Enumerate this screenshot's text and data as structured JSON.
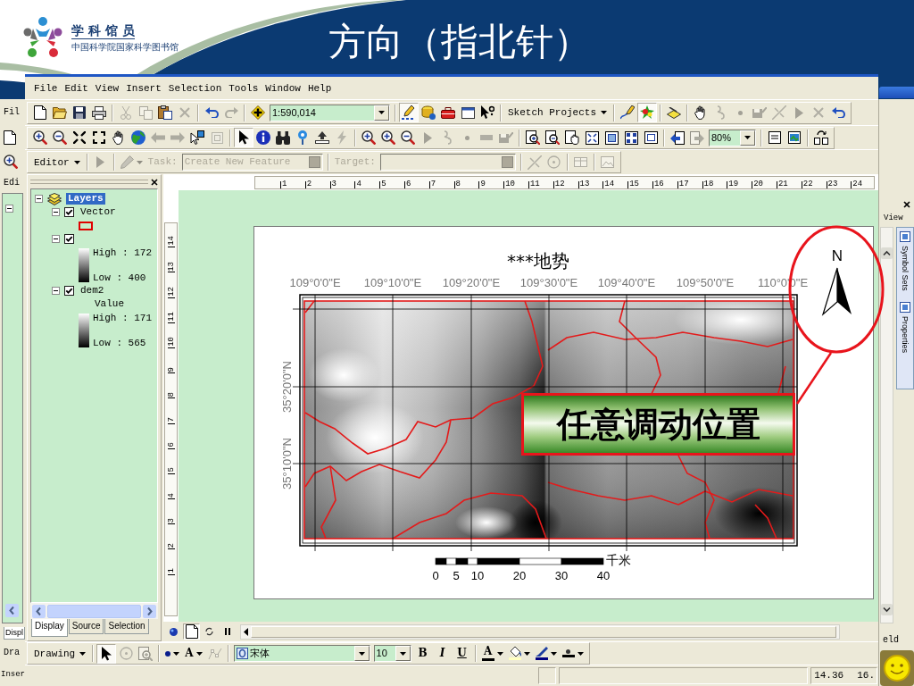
{
  "slide": {
    "logo": {
      "name": "学 科 馆 员",
      "subtitle": "中国科学院国家科学图书馆"
    },
    "title": "方向（指北针）"
  },
  "background_window": {
    "left": {
      "menu": "Fil",
      "panel_tab": "Edi",
      "tab": "Displ",
      "toolbar_menu": "Dra",
      "status": "Inser"
    },
    "right": {
      "tab": "View",
      "vertical_tabs": [
        "Symbol Sets",
        "Properties"
      ],
      "field": "eld"
    }
  },
  "menu_bar": [
    "File",
    "Edit",
    "View",
    "Insert",
    "Selection",
    "Tools",
    "Window",
    "Help"
  ],
  "toolbars": [
    {
      "groups": [
        [
          {
            "kind": "tool",
            "disabled": false,
            "pressed": false
          },
          {
            "kind": "tool",
            "disabled": false,
            "pressed": false
          },
          {
            "kind": "tool",
            "disabled": false,
            "pressed": false
          },
          {
            "kind": "tool",
            "disabled": false,
            "pressed": false
          }
        ],
        [
          {
            "kind": "tool",
            "disabled": true,
            "pressed": false
          },
          {
            "kind": "tool",
            "disabled": true,
            "pressed": false
          },
          {
            "kind": "tool",
            "disabled": false,
            "pressed": false
          },
          {
            "kind": "tool",
            "disabled": true,
            "pressed": false
          }
        ],
        [
          {
            "kind": "tool",
            "disabled": false,
            "pressed": false
          },
          {
            "kind": "tool",
            "disabled": true,
            "pressed": false
          }
        ],
        [
          {
            "kind": "tool",
            "disabled": false,
            "pressed": false
          },
          {
            "kind": "combo",
            "value": "1:590,014"
          }
        ],
        [
          {
            "kind": "tool",
            "disabled": false,
            "pressed": true
          },
          {
            "kind": "tool",
            "disabled": false,
            "pressed": false
          },
          {
            "kind": "tool",
            "disabled": false,
            "pressed": false
          },
          {
            "kind": "tool",
            "disabled": false,
            "pressed": false
          },
          {
            "kind": "tool",
            "disabled": false,
            "pressed": false
          }
        ],
        [
          {
            "kind": "menu",
            "label": "Sketch Projects"
          }
        ],
        [
          {
            "kind": "tool",
            "disabled": false,
            "pressed": false
          },
          {
            "kind": "tool",
            "disabled": false,
            "pressed": true
          }
        ],
        [
          {
            "kind": "tool",
            "disabled": false,
            "pressed": false
          }
        ],
        [
          {
            "kind": "tool",
            "disabled": false,
            "pressed": false
          },
          {
            "kind": "tool",
            "disabled": true,
            "pressed": false
          },
          {
            "kind": "tool",
            "disabled": true,
            "pressed": false
          },
          {
            "kind": "tool",
            "disabled": true,
            "pressed": false
          },
          {
            "kind": "tool",
            "disabled": true,
            "pressed": false
          },
          {
            "kind": "tool",
            "disabled": true,
            "pressed": false
          },
          {
            "kind": "tool",
            "disabled": true,
            "pressed": false
          },
          {
            "kind": "tool",
            "disabled": false,
            "pressed": false
          }
        ]
      ]
    },
    {
      "groups": [
        [
          {
            "kind": "tool",
            "disabled": false,
            "pressed": false
          },
          {
            "kind": "tool",
            "disabled": false,
            "pressed": false
          },
          {
            "kind": "tool",
            "disabled": false,
            "pressed": false
          },
          {
            "kind": "tool",
            "disabled": false,
            "pressed": false
          },
          {
            "kind": "tool",
            "disabled": false,
            "pressed": false
          },
          {
            "kind": "tool",
            "disabled": false,
            "pressed": false
          },
          {
            "kind": "tool",
            "disabled": true,
            "pressed": false
          },
          {
            "kind": "tool",
            "disabled": true,
            "pressed": false
          },
          {
            "kind": "tool",
            "disabled": false,
            "pressed": false
          },
          {
            "kind": "tool",
            "disabled": true,
            "pressed": false
          }
        ],
        [
          {
            "kind": "tool",
            "disabled": false,
            "pressed": true
          },
          {
            "kind": "tool",
            "disabled": false,
            "pressed": false
          },
          {
            "kind": "tool",
            "disabled": false,
            "pressed": false
          },
          {
            "kind": "tool",
            "disabled": false,
            "pressed": false
          },
          {
            "kind": "tool",
            "disabled": false,
            "pressed": false
          },
          {
            "kind": "tool",
            "disabled": true,
            "pressed": false
          }
        ],
        [
          {
            "kind": "tool",
            "disabled": false,
            "pressed": false
          },
          {
            "kind": "tool",
            "disabled": false,
            "pressed": false
          },
          {
            "kind": "tool",
            "disabled": false,
            "pressed": false
          },
          {
            "kind": "tool",
            "disabled": true,
            "pressed": false
          },
          {
            "kind": "tool",
            "disabled": true,
            "pressed": false
          },
          {
            "kind": "tool",
            "disabled": true,
            "pressed": false
          },
          {
            "kind": "tool",
            "disabled": true,
            "pressed": false
          },
          {
            "kind": "tool",
            "disabled": true,
            "pressed": false
          }
        ],
        [
          {
            "kind": "tool",
            "disabled": false,
            "pressed": false
          },
          {
            "kind": "tool",
            "disabled": false,
            "pressed": false
          },
          {
            "kind": "tool",
            "disabled": false,
            "pressed": false
          },
          {
            "kind": "tool",
            "disabled": false,
            "pressed": false
          },
          {
            "kind": "tool",
            "disabled": false,
            "pressed": false
          },
          {
            "kind": "tool",
            "disabled": false,
            "pressed": false
          },
          {
            "kind": "tool",
            "disabled": false,
            "pressed": false
          }
        ],
        [
          {
            "kind": "tool",
            "disabled": false,
            "pressed": false
          },
          {
            "kind": "tool",
            "disabled": true,
            "pressed": false
          },
          {
            "kind": "combo",
            "value": "80%"
          }
        ],
        [
          {
            "kind": "tool",
            "disabled": false,
            "pressed": false
          },
          {
            "kind": "tool",
            "disabled": false,
            "pressed": false
          }
        ],
        [
          {
            "kind": "tool",
            "disabled": false,
            "pressed": false
          }
        ]
      ]
    },
    {
      "groups": [
        [
          {
            "kind": "menu",
            "label": "Editor"
          }
        ],
        [
          {
            "kind": "tool",
            "disabled": true,
            "pressed": false
          }
        ],
        [
          {
            "kind": "split",
            "disabled": true,
            "pressed": false
          },
          {
            "kind": "label",
            "label": "Task:",
            "disabled": true
          },
          {
            "kind": "field",
            "value": "Create New Feature",
            "disabled": true
          }
        ],
        [
          {
            "kind": "label",
            "label": "Target:",
            "disabled": true
          },
          {
            "kind": "field",
            "disabled": true
          }
        ],
        [
          {
            "kind": "tool",
            "disabled": true,
            "pressed": false
          },
          {
            "kind": "tool",
            "disabled": true,
            "pressed": false
          }
        ],
        [
          {
            "kind": "tool",
            "disabled": true,
            "pressed": false
          }
        ],
        [
          {
            "kind": "tool",
            "disabled": true,
            "pressed": false
          }
        ]
      ]
    },
    {
      "groups": [
        [
          {
            "kind": "menu",
            "label": "Drawing"
          }
        ],
        [
          {
            "kind": "tool",
            "disabled": false,
            "pressed": true
          },
          {
            "kind": "tool",
            "disabled": true,
            "pressed": false
          },
          {
            "kind": "tool",
            "disabled": true,
            "pressed": false
          }
        ],
        [
          {
            "kind": "split",
            "disabled": false,
            "pressed": false
          },
          {
            "kind": "text-split",
            "label": "A",
            "disabled": false,
            "pressed": false
          },
          {
            "kind": "tool",
            "disabled": true,
            "pressed": false
          }
        ],
        [
          {
            "kind": "font-combo",
            "value": "宋体"
          },
          {
            "kind": "combo",
            "value": "10"
          },
          {
            "kind": "text-tool",
            "label": "B",
            "disabled": false,
            "pressed": false
          },
          {
            "kind": "text-tool",
            "label": "I",
            "disabled": false,
            "pressed": false
          },
          {
            "kind": "text-tool",
            "label": "U",
            "disabled": false,
            "pressed": false
          }
        ],
        [
          {
            "kind": "color-text",
            "label": "A",
            "color": "#000000",
            "disabled": false,
            "pressed": false
          },
          {
            "kind": "color-split",
            "color": "#ffffc0",
            "disabled": false,
            "pressed": false
          },
          {
            "kind": "color-split",
            "color": "#000080",
            "disabled": false,
            "pressed": false
          },
          {
            "kind": "color-split",
            "color": "#000000",
            "disabled": false,
            "pressed": false
          }
        ]
      ]
    }
  ],
  "toc": {
    "tree": {
      "label": "Layers",
      "expanded": true,
      "selected": true,
      "children": [
        {
          "label": "Vector",
          "expanded": true,
          "checked": true,
          "selected": false,
          "legend": {
            "kind": "outline",
            "color": "#e00000"
          }
        },
        {
          "expanded": true,
          "checked": true,
          "selected": false,
          "legend": {
            "kind": "ramp",
            "high": "High : 172",
            "low": "Low : 400"
          }
        },
        {
          "label": "dem2",
          "expanded": true,
          "checked": true,
          "selected": false,
          "legend": {
            "kind": "ramp",
            "heading": "Value",
            "high": "High : 171",
            "low": "Low : 565"
          }
        }
      ]
    },
    "tabs": [
      {
        "label": "Display",
        "selected": true
      },
      {
        "label": "Source",
        "selected": false
      },
      {
        "label": "Selection",
        "selected": false
      }
    ]
  },
  "layout_view": {
    "top_ruler": [
      "1",
      "2",
      "3",
      "4",
      "5",
      "6",
      "7",
      "8",
      "9",
      "10",
      "11",
      "12",
      "13",
      "14",
      "15",
      "16",
      "17",
      "18",
      "19",
      "20",
      "21",
      "22",
      "23",
      "24"
    ],
    "left_ruler": [
      "14",
      "13",
      "12",
      "11",
      "10",
      "9",
      "8",
      "7",
      "6",
      "5",
      "4",
      "3",
      "2",
      "1"
    ],
    "page": {
      "title": "***地势",
      "longitude_labels": [
        "109°0'0\"E",
        "109°10'0\"E",
        "109°20'0\"E",
        "109°30'0\"E",
        "109°40'0\"E",
        "109°50'0\"E",
        "110°0'0\"E"
      ],
      "latitude_labels": [
        "35°20'0\"N",
        "35°10'0\"N"
      ],
      "scale_bar": {
        "labels": [
          "0",
          "5",
          "10",
          "20",
          "30",
          "40"
        ],
        "unit": "千米"
      },
      "north_arrow": "N"
    },
    "view_buttons": [
      {
        "pressed": false
      },
      {
        "pressed": true
      },
      {
        "pressed": false
      },
      {
        "pressed": false
      }
    ]
  },
  "status_bar": {
    "readings": [
      "14.36",
      "16."
    ]
  },
  "annotation": {
    "callout": "任意调动位置"
  }
}
